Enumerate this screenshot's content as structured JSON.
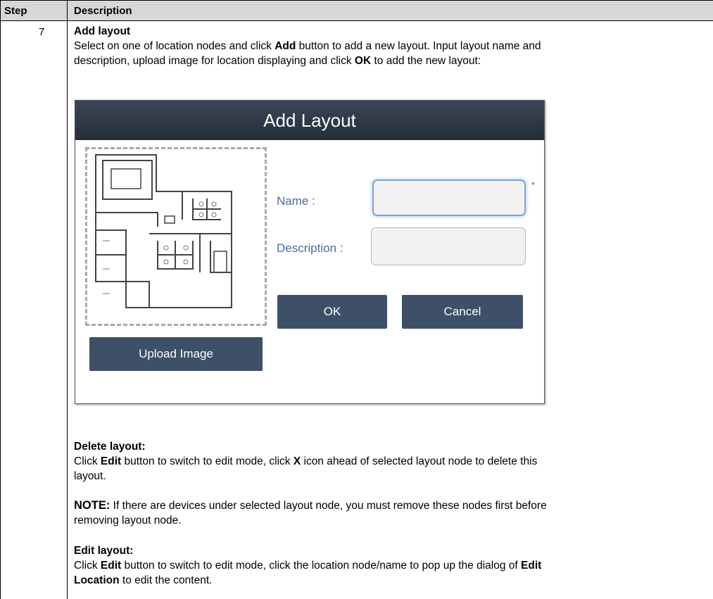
{
  "table": {
    "col_step": "Step",
    "col_description": "Description",
    "step_number": "7"
  },
  "add_layout": {
    "heading": "Add layout",
    "line1_a": "Select on one of location nodes and click ",
    "line1_b": "Add",
    "line1_c": " button to add a new layout. Input layout name and",
    "line2_a": "description, upload image for location displaying and click ",
    "line2_b": "OK",
    "line2_c": " to add the new layout:"
  },
  "dialog": {
    "title": "Add Layout",
    "name_label": "Name :",
    "description_label": "Description :",
    "required_mark": "*",
    "ok_label": "OK",
    "cancel_label": "Cancel",
    "upload_label": "Upload Image"
  },
  "delete_layout": {
    "heading": "Delete layout:",
    "line1_a": "Click ",
    "line1_b": "Edit",
    "line1_c": " button to switch to edit mode, click ",
    "line1_d": "X",
    "line1_e": " icon ahead of selected layout node to delete this",
    "line2": "layout."
  },
  "note": {
    "label": "NOTE:",
    "line1": " If there are devices under selected layout node, you must remove these nodes first before",
    "line2": "removing layout node."
  },
  "edit_layout": {
    "heading": "Edit layout:",
    "line1_a": "Click ",
    "line1_b": "Edit",
    "line1_c": " button to switch to edit mode, click the location node/name to pop up the dialog of ",
    "line1_d": "Edit",
    "line2_a": "Location",
    "line2_b": " to edit the content."
  }
}
